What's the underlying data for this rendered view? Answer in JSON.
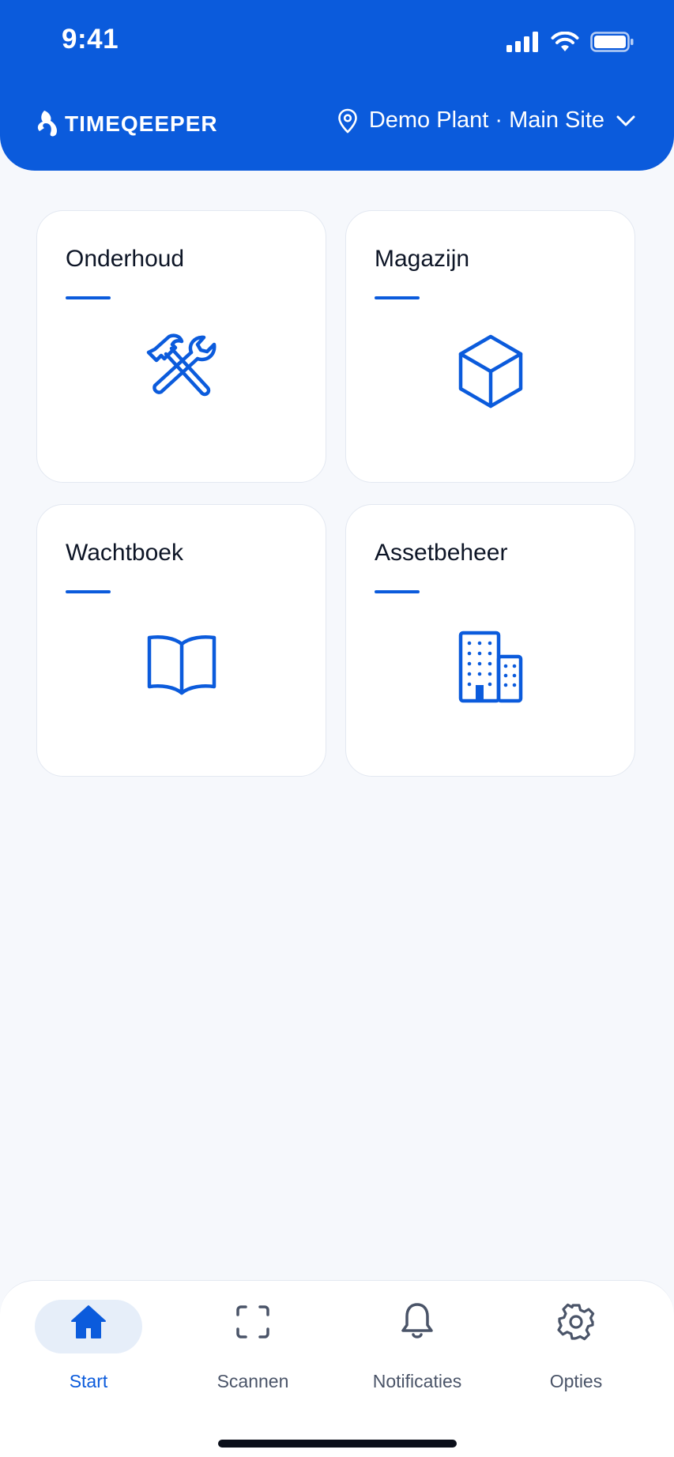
{
  "status_bar": {
    "time": "9:41"
  },
  "header": {
    "brand": "TIMEQEEPER",
    "location": "Demo Plant · Main Site",
    "accent": "#0b5bdc"
  },
  "tiles": [
    {
      "title": "Onderhoud",
      "icon": "wrench-hammer-icon"
    },
    {
      "title": "Magazijn",
      "icon": "cube-icon"
    },
    {
      "title": "Wachtboek",
      "icon": "open-book-icon"
    },
    {
      "title": "Assetbeheer",
      "icon": "buildings-icon"
    }
  ],
  "nav": {
    "items": [
      {
        "label": "Start",
        "icon": "home-icon",
        "active": true
      },
      {
        "label": "Scannen",
        "icon": "scan-icon",
        "active": false
      },
      {
        "label": "Notificaties",
        "icon": "bell-icon",
        "active": false
      },
      {
        "label": "Opties",
        "icon": "gear-icon",
        "active": false
      }
    ]
  }
}
